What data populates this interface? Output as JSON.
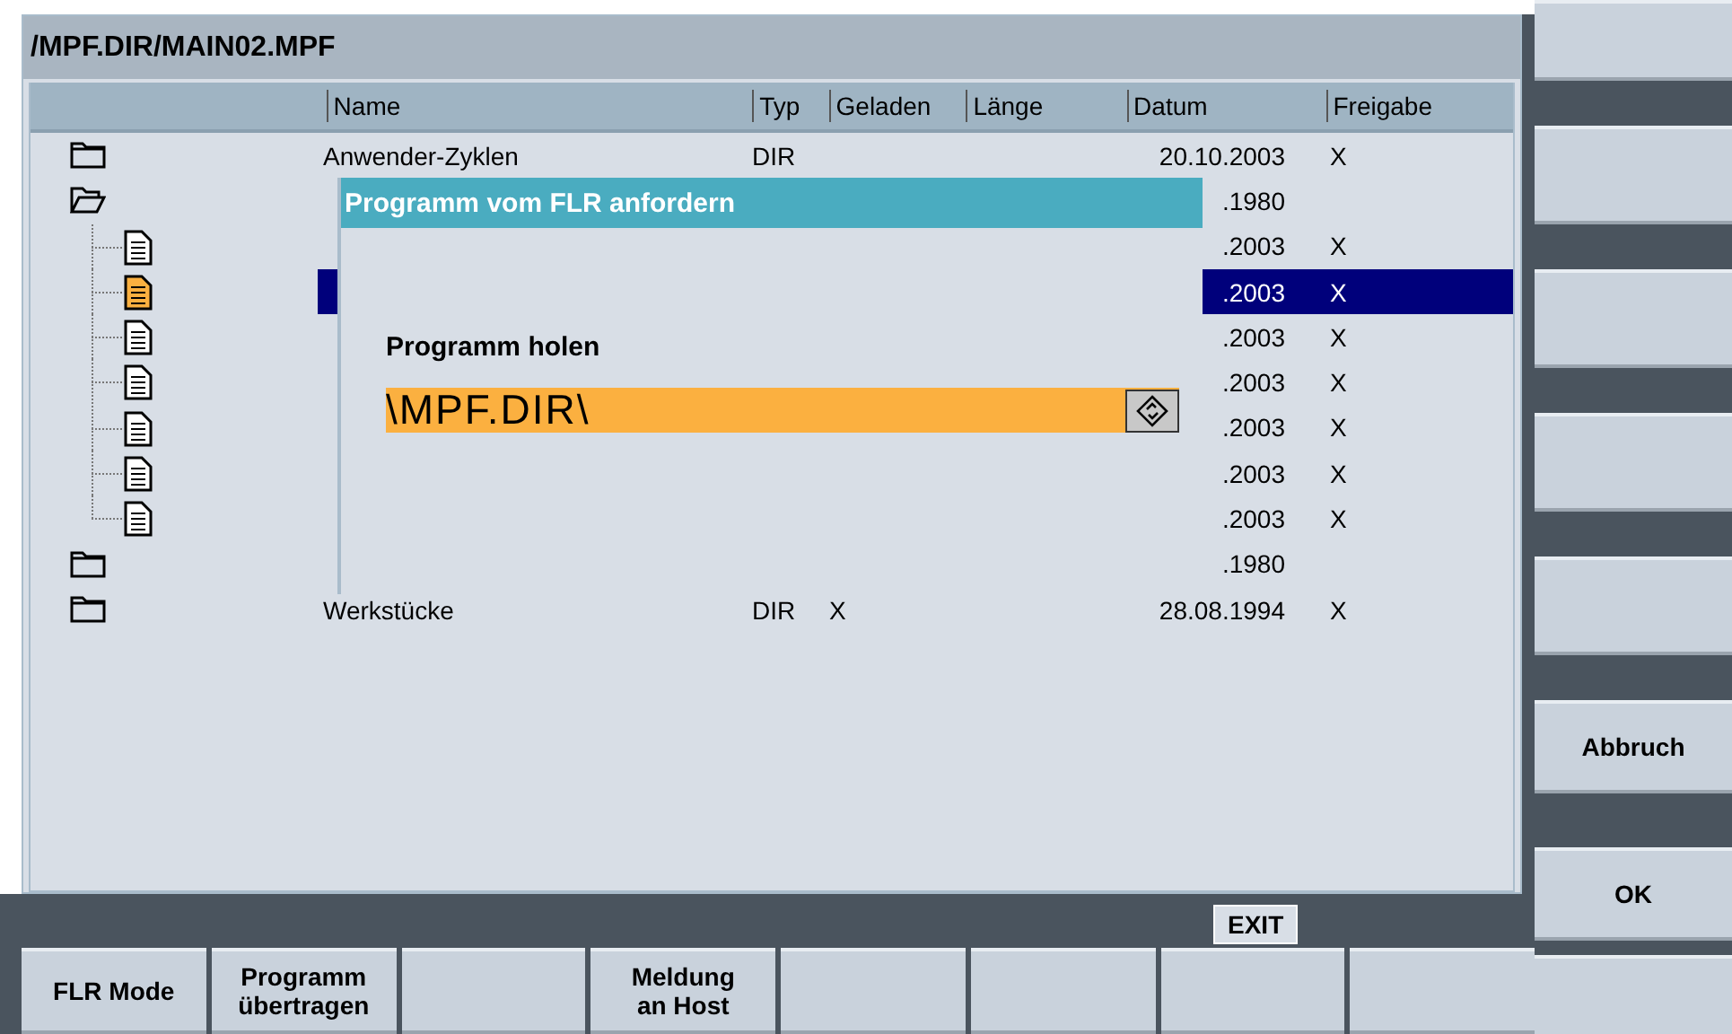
{
  "path_title": "/MPF.DIR/MAIN02.MPF",
  "columns": [
    "Name",
    "Typ",
    "Geladen",
    "Länge",
    "Datum",
    "Freigabe"
  ],
  "items": [
    {
      "kind": "folder",
      "expanded": false,
      "selected": false,
      "name": "Anwender-Zyklen",
      "typ": "DIR",
      "datum": "20.10.2003",
      "freigabe": "X"
    },
    {
      "kind": "folder",
      "expanded": true,
      "selected": false,
      "datum": ".1980",
      "children": [
        {
          "kind": "file",
          "selected": false,
          "datum": ".2003",
          "freigabe": "X"
        },
        {
          "kind": "file",
          "selected": true,
          "datum": ".2003",
          "freigabe": "X"
        },
        {
          "kind": "file",
          "selected": false,
          "datum": ".2003",
          "freigabe": "X"
        },
        {
          "kind": "file",
          "selected": false,
          "datum": ".2003",
          "freigabe": "X"
        },
        {
          "kind": "file",
          "selected": false,
          "datum": ".2003",
          "freigabe": "X"
        },
        {
          "kind": "file",
          "selected": false,
          "datum": ".2003",
          "freigabe": "X"
        },
        {
          "kind": "file",
          "selected": false,
          "datum": ".2003",
          "freigabe": "X"
        }
      ]
    },
    {
      "kind": "folder",
      "expanded": false,
      "selected": false,
      "datum": ".1980"
    },
    {
      "kind": "folder",
      "expanded": false,
      "selected": false,
      "name": "Werkstücke",
      "typ": "DIR",
      "geladen": "X",
      "datum": "28.08.1994",
      "freigabe": "X"
    }
  ],
  "dialog": {
    "title": "Programm vom FLR anfordern",
    "label": "Programm holen",
    "value": "\\MPF.DIR\\"
  },
  "exit_label": "EXIT",
  "right_softkeys": [
    {
      "kind": "blank"
    },
    {
      "kind": "blank"
    },
    {
      "kind": "blank"
    },
    {
      "kind": "blank"
    },
    {
      "kind": "blank"
    },
    {
      "kind": "labeled",
      "label": "Abbruch"
    },
    {
      "kind": "labeled",
      "label": "OK"
    },
    {
      "kind": "blank"
    }
  ],
  "bottom_softkeys": [
    {
      "kind": "labeled",
      "label": "FLR Mode"
    },
    {
      "kind": "labeled",
      "label": "Programm übertragen"
    },
    {
      "kind": "blank"
    },
    {
      "kind": "labeled",
      "label": "Meldung an Host"
    },
    {
      "kind": "blank"
    },
    {
      "kind": "blank"
    },
    {
      "kind": "blank"
    },
    {
      "kind": "blank"
    }
  ]
}
